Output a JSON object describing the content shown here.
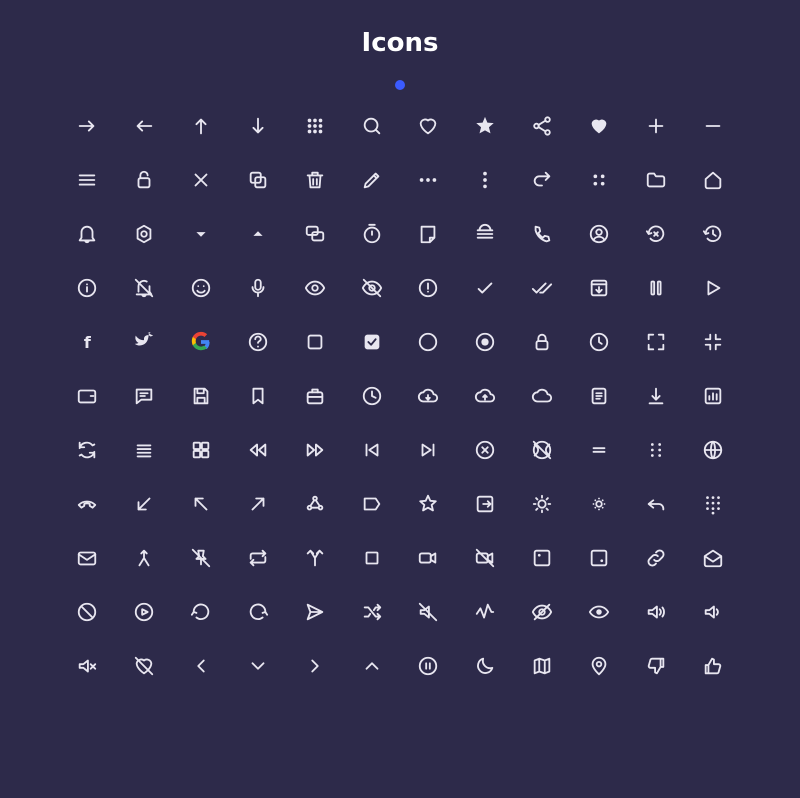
{
  "title": "Icons",
  "accent_dot_color": "#3b5bff",
  "background_color": "#2d2a4a",
  "icons": [
    [
      "arrow-right",
      "arrow-left",
      "arrow-up",
      "arrow-down",
      "grid-dots",
      "search",
      "heart-outline",
      "star-filled",
      "share",
      "heart-filled",
      "plus",
      "minus"
    ],
    [
      "menu",
      "unlock",
      "close",
      "copy",
      "trash",
      "edit",
      "more-horiz",
      "more-vert",
      "redo",
      "four-dots",
      "folder",
      "home"
    ],
    [
      "bell",
      "settings-hex",
      "caret-down",
      "caret-up",
      "comments",
      "timer",
      "note",
      "burger-menu",
      "phone",
      "user-circle",
      "error-refresh",
      "history"
    ],
    [
      "info",
      "bell-off",
      "smile",
      "mic",
      "eye",
      "eye-off",
      "alert-circle",
      "check",
      "double-check",
      "archive-down",
      "pause",
      "play"
    ],
    [
      "facebook",
      "twitter",
      "google",
      "help-circle",
      "square",
      "checkbox-checked",
      "circle-outline",
      "radio-selected",
      "lock",
      "clock",
      "fullscreen",
      "exit-fullscreen"
    ],
    [
      "wallet",
      "message",
      "save",
      "bookmark",
      "briefcase",
      "clock-outline",
      "cloud-download",
      "cloud-upload",
      "cloud",
      "document",
      "download",
      "bar-chart"
    ],
    [
      "refresh",
      "list",
      "grid-apps",
      "rewind",
      "fast-forward",
      "skip-back",
      "skip-forward",
      "close-circle",
      "offline",
      "equals",
      "drag-dots",
      "globe"
    ],
    [
      "phone-hangup",
      "arrow-down-left",
      "arrow-up-left",
      "arrow-up-right",
      "share-nodes",
      "tag",
      "star-outline",
      "exit",
      "brightness-high",
      "brightness-low",
      "reply",
      "dialpad"
    ],
    [
      "mail",
      "merge",
      "pin-off",
      "repeat",
      "split",
      "stop",
      "video",
      "video-off",
      "point-tl",
      "point-br",
      "link",
      "mail-open"
    ],
    [
      "block",
      "play-circle",
      "rotate-ccw",
      "rotate-cw",
      "send",
      "shuffle",
      "volume-off",
      "activity",
      "strikethrough",
      "eye-open",
      "speaker",
      "volume-down"
    ],
    [
      "volume-mute",
      "heart-broken",
      "chevron-left",
      "chevron-down",
      "chevron-right",
      "chevron-up",
      "pause-circle",
      "moon",
      "map",
      "map-pin",
      "thumbs-down",
      "thumbs-up"
    ]
  ]
}
